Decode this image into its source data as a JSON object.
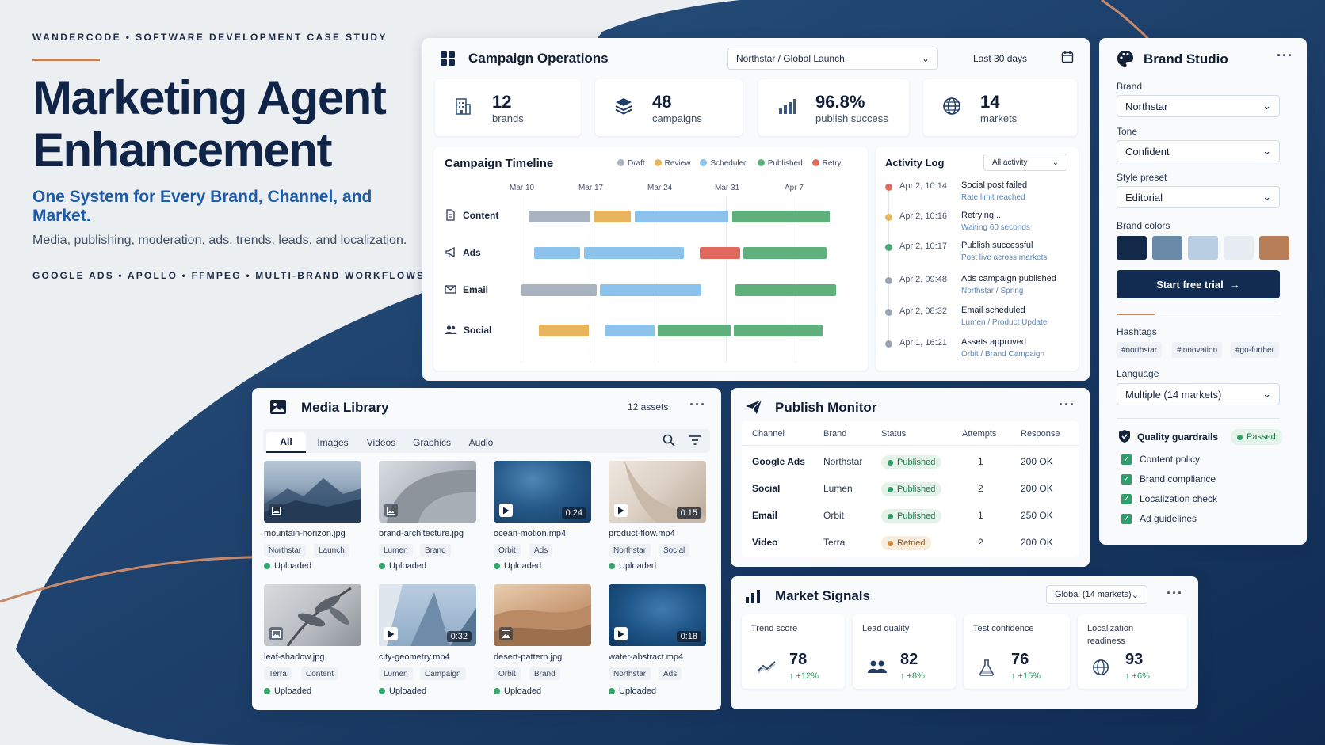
{
  "hero": {
    "eyebrow": "WANDERCODE • SOFTWARE DEVELOPMENT CASE STUDY",
    "title_line1": "Marketing Agent",
    "title_line2": "Enhancement",
    "subtitle": "One System for Every Brand, Channel, and Market.",
    "description": "Media, publishing, moderation, ads, trends, leads, and localization.",
    "tags": "GOOGLE ADS • APOLLO • FFMPEG • MULTI-BRAND WORKFLOWS"
  },
  "campaign_ops": {
    "title": "Campaign Operations",
    "workspace_select": "Northstar / Global Launch",
    "range": "Last 30 days",
    "kpis": [
      {
        "value": "12",
        "label": "brands",
        "icon": "building-icon"
      },
      {
        "value": "48",
        "label": "campaigns",
        "icon": "layers-icon"
      },
      {
        "value": "96.8%",
        "label": "publish success",
        "icon": "bar-chart-icon"
      },
      {
        "value": "14",
        "label": "markets",
        "icon": "globe-icon"
      }
    ],
    "timeline": {
      "title": "Campaign Timeline",
      "legend": [
        {
          "label": "Draft",
          "color": "#a9b2bf"
        },
        {
          "label": "Review",
          "color": "#e8b45c"
        },
        {
          "label": "Scheduled",
          "color": "#8cc3ec"
        },
        {
          "label": "Published",
          "color": "#5fb07d"
        },
        {
          "label": "Retry",
          "color": "#e06a5e"
        }
      ],
      "dates": [
        "Mar 10",
        "Mar 17",
        "Mar 24",
        "Mar 31",
        "Apr 7"
      ],
      "rows": [
        {
          "label": "Content",
          "icon": "document-icon"
        },
        {
          "label": "Ads",
          "icon": "megaphone-icon"
        },
        {
          "label": "Email",
          "icon": "mail-icon"
        },
        {
          "label": "Social",
          "icon": "users-icon"
        }
      ]
    },
    "activity": {
      "title": "Activity Log",
      "filter": "All activity",
      "items": [
        {
          "time": "Apr 2, 10:14",
          "title": "Social post failed",
          "desc": "Rate limit reached",
          "color": "#e06a5e"
        },
        {
          "time": "Apr 2, 10:16",
          "title": "Retrying...",
          "desc": "Waiting 60 seconds",
          "color": "#e8b45c"
        },
        {
          "time": "Apr 2, 10:17",
          "title": "Publish successful",
          "desc": "Post live across markets",
          "color": "#4aa873"
        },
        {
          "time": "Apr 2, 09:48",
          "title": "Ads campaign published",
          "desc": "Northstar / Spring",
          "color": "#9aa4b3"
        },
        {
          "time": "Apr 2, 08:32",
          "title": "Email scheduled",
          "desc": "Lumen / Product Update",
          "color": "#9aa4b3"
        },
        {
          "time": "Apr 1, 16:21",
          "title": "Assets approved",
          "desc": "Orbit / Brand Campaign",
          "color": "#9aa4b3"
        }
      ]
    }
  },
  "brand_studio": {
    "title": "Brand Studio",
    "brand_label": "Brand",
    "brand_value": "Northstar",
    "tone_label": "Tone",
    "tone_value": "Confident",
    "style_label": "Style preset",
    "style_value": "Editorial",
    "colors_label": "Brand colors",
    "colors": [
      "#13294a",
      "#6b89a8",
      "#b9cde3",
      "#e7edf3",
      "#b77e58"
    ],
    "cta": "Start free trial",
    "hashtags_label": "Hashtags",
    "hashtags": [
      "#northstar",
      "#innovation",
      "#go-further"
    ],
    "language_label": "Language",
    "language_value": "Multiple (14 markets)",
    "guardrails_title": "Quality guardrails",
    "guardrails_status": "Passed",
    "checks": [
      "Content policy",
      "Brand compliance",
      "Localization check",
      "Ad guidelines"
    ]
  },
  "media_library": {
    "title": "Media Library",
    "count": "12 assets",
    "tabs": [
      "All",
      "Images",
      "Videos",
      "Graphics",
      "Audio"
    ],
    "assets": [
      {
        "name": "mountain-horizon.jpg",
        "tags": [
          "Northstar",
          "Launch"
        ],
        "status": "Uploaded",
        "duration": "",
        "kind": "image"
      },
      {
        "name": "brand-architecture.jpg",
        "tags": [
          "Lumen",
          "Brand"
        ],
        "status": "Uploaded",
        "duration": "",
        "kind": "image"
      },
      {
        "name": "ocean-motion.mp4",
        "tags": [
          "Orbit",
          "Ads"
        ],
        "status": "Uploaded",
        "duration": "0:24",
        "kind": "video"
      },
      {
        "name": "product-flow.mp4",
        "tags": [
          "Northstar",
          "Social"
        ],
        "status": "Uploaded",
        "duration": "0:15",
        "kind": "video"
      },
      {
        "name": "leaf-shadow.jpg",
        "tags": [
          "Terra",
          "Content"
        ],
        "status": "Uploaded",
        "duration": "",
        "kind": "image"
      },
      {
        "name": "city-geometry.mp4",
        "tags": [
          "Lumen",
          "Campaign"
        ],
        "status": "Uploaded",
        "duration": "0:32",
        "kind": "video"
      },
      {
        "name": "desert-pattern.jpg",
        "tags": [
          "Orbit",
          "Brand"
        ],
        "status": "Uploaded",
        "duration": "",
        "kind": "image"
      },
      {
        "name": "water-abstract.mp4",
        "tags": [
          "Northstar",
          "Ads"
        ],
        "status": "Uploaded",
        "duration": "0:18",
        "kind": "video"
      }
    ]
  },
  "publish_monitor": {
    "title": "Publish Monitor",
    "columns": [
      "Channel",
      "Brand",
      "Status",
      "Attempts",
      "Response"
    ],
    "rows": [
      {
        "channel": "Google Ads",
        "brand": "Northstar",
        "status": "Published",
        "attempts": "1",
        "response": "200 OK"
      },
      {
        "channel": "Social",
        "brand": "Lumen",
        "status": "Published",
        "attempts": "2",
        "response": "200 OK"
      },
      {
        "channel": "Email",
        "brand": "Orbit",
        "status": "Published",
        "attempts": "1",
        "response": "250 OK"
      },
      {
        "channel": "Video",
        "brand": "Terra",
        "status": "Retried",
        "attempts": "2",
        "response": "200 OK"
      }
    ]
  },
  "market_signals": {
    "title": "Market Signals",
    "scope": "Global (14 markets)",
    "cards": [
      {
        "label": "Trend score",
        "value": "78",
        "delta": "↑ +12%",
        "icon": "trend-icon"
      },
      {
        "label": "Lead quality",
        "value": "82",
        "delta": "↑ +8%",
        "icon": "people-icon"
      },
      {
        "label": "Test confidence",
        "value": "76",
        "delta": "↑ +15%",
        "icon": "flask-icon"
      },
      {
        "label": "Localization readiness",
        "value": "93",
        "delta": "↑ +6%",
        "icon": "globe-icon"
      }
    ]
  }
}
